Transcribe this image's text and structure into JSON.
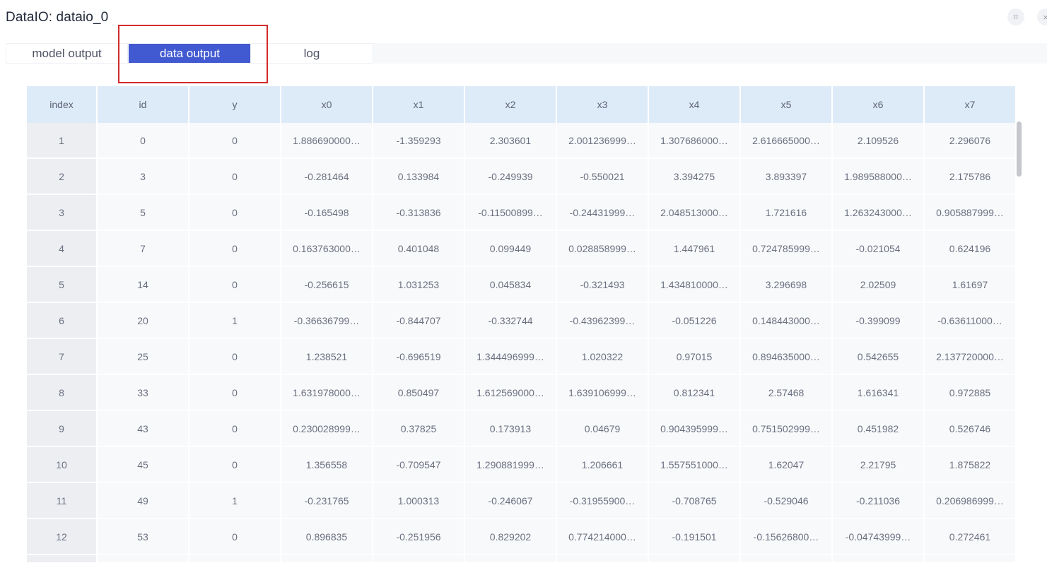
{
  "window": {
    "title": "DataIO: dataio_0",
    "buttons": [
      {
        "name": "fullscreen-icon",
        "glyph": "⌗"
      },
      {
        "name": "close-icon",
        "glyph": "×"
      }
    ]
  },
  "tabs": [
    {
      "label": "model output",
      "active": false
    },
    {
      "label": "data output",
      "active": true
    },
    {
      "label": "log",
      "active": false
    }
  ],
  "colors": {
    "active_tab": "#4159d1",
    "highlight_box": "#d42b2b",
    "header_bg": "#ddeaf8"
  },
  "table": {
    "columns": [
      "index",
      "id",
      "y",
      "x0",
      "x1",
      "x2",
      "x3",
      "x4",
      "x5",
      "x6",
      "x7"
    ],
    "rows": [
      [
        "1",
        "0",
        "0",
        "1.886690000…",
        "-1.359293",
        "2.303601",
        "2.001236999…",
        "1.307686000…",
        "2.616665000…",
        "2.109526",
        "2.296076"
      ],
      [
        "2",
        "3",
        "0",
        "-0.281464",
        "0.133984",
        "-0.249939",
        "-0.550021",
        "3.394275",
        "3.893397",
        "1.989588000…",
        "2.175786"
      ],
      [
        "3",
        "5",
        "0",
        "-0.165498",
        "-0.313836",
        "-0.11500899…",
        "-0.24431999…",
        "2.048513000…",
        "1.721616",
        "1.263243000…",
        "0.905887999…"
      ],
      [
        "4",
        "7",
        "0",
        "0.163763000…",
        "0.401048",
        "0.099449",
        "0.028858999…",
        "1.447961",
        "0.724785999…",
        "-0.021054",
        "0.624196"
      ],
      [
        "5",
        "14",
        "0",
        "-0.256615",
        "1.031253",
        "0.045834",
        "-0.321493",
        "1.434810000…",
        "3.296698",
        "2.02509",
        "1.61697"
      ],
      [
        "6",
        "20",
        "1",
        "-0.36636799…",
        "-0.844707",
        "-0.332744",
        "-0.43962399…",
        "-0.051226",
        "0.148443000…",
        "-0.399099",
        "-0.63611000…"
      ],
      [
        "7",
        "25",
        "0",
        "1.238521",
        "-0.696519",
        "1.344496999…",
        "1.020322",
        "0.97015",
        "0.894635000…",
        "0.542655",
        "2.137720000…"
      ],
      [
        "8",
        "33",
        "0",
        "1.631978000…",
        "0.850497",
        "1.612569000…",
        "1.639106999…",
        "0.812341",
        "2.57468",
        "1.616341",
        "0.972885"
      ],
      [
        "9",
        "43",
        "0",
        "0.230028999…",
        "0.37825",
        "0.173913",
        "0.04679",
        "0.904395999…",
        "0.751502999…",
        "0.451982",
        "0.526746"
      ],
      [
        "10",
        "45",
        "0",
        "1.356558",
        "-0.709547",
        "1.290881999…",
        "1.206661",
        "1.557551000…",
        "1.62047",
        "2.21795",
        "1.875822"
      ],
      [
        "11",
        "49",
        "1",
        "-0.231765",
        "1.000313",
        "-0.246067",
        "-0.31955900…",
        "-0.708765",
        "-0.529046",
        "-0.211036",
        "0.206986999…"
      ],
      [
        "12",
        "53",
        "0",
        "0.896835",
        "-0.251956",
        "0.829202",
        "0.774214000…",
        "-0.191501",
        "-0.15626800…",
        "-0.04743999…",
        "0.272461"
      ]
    ]
  }
}
